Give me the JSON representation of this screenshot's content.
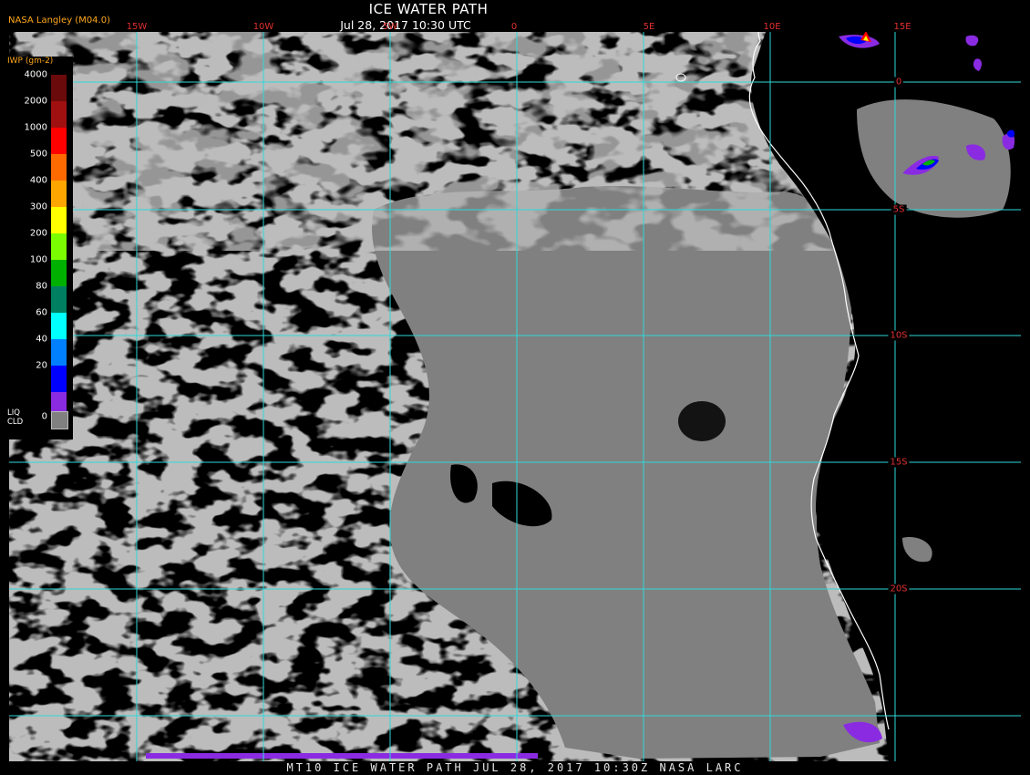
{
  "header": {
    "title": "ICE WATER PATH",
    "subtitle": "Jul 28, 2017 10:30 UTC",
    "org": "NASA Langley (M04.0)"
  },
  "footer": {
    "text": "MT10  ICE WATER PATH  JUL 28, 2017 10:30Z  NASA LARC"
  },
  "map": {
    "lon_labels": [
      "15W",
      "10W",
      "5W",
      "0",
      "5E",
      "10E",
      "15E"
    ],
    "lat_labels": [
      "0",
      "5S",
      "10S",
      "15S",
      "20S"
    ],
    "colors": {
      "liquid_cloud": "#808080",
      "clear": "#000000",
      "grid": "#2fd8d8",
      "coast": "#ffffff",
      "labels": "#e03030"
    }
  },
  "legend": {
    "title": "IWP (gm-2)",
    "levels": [
      {
        "label": "4000",
        "color": "#6b0a0a"
      },
      {
        "label": "2000",
        "color": "#a01010"
      },
      {
        "label": "1000",
        "color": "#ff0000"
      },
      {
        "label": "500",
        "color": "#ff6a00"
      },
      {
        "label": "400",
        "color": "#ffa500"
      },
      {
        "label": "300",
        "color": "#ffff00"
      },
      {
        "label": "200",
        "color": "#7cfc00"
      },
      {
        "label": "100",
        "color": "#00b000"
      },
      {
        "label": "80",
        "color": "#008060"
      },
      {
        "label": "60",
        "color": "#00ffff"
      },
      {
        "label": "40",
        "color": "#0080ff"
      },
      {
        "label": "20",
        "color": "#0000ff"
      },
      {
        "label": "0",
        "color": "#8a2be2"
      }
    ],
    "liq_label_1": "LIQ",
    "liq_label_2": "CLD"
  }
}
